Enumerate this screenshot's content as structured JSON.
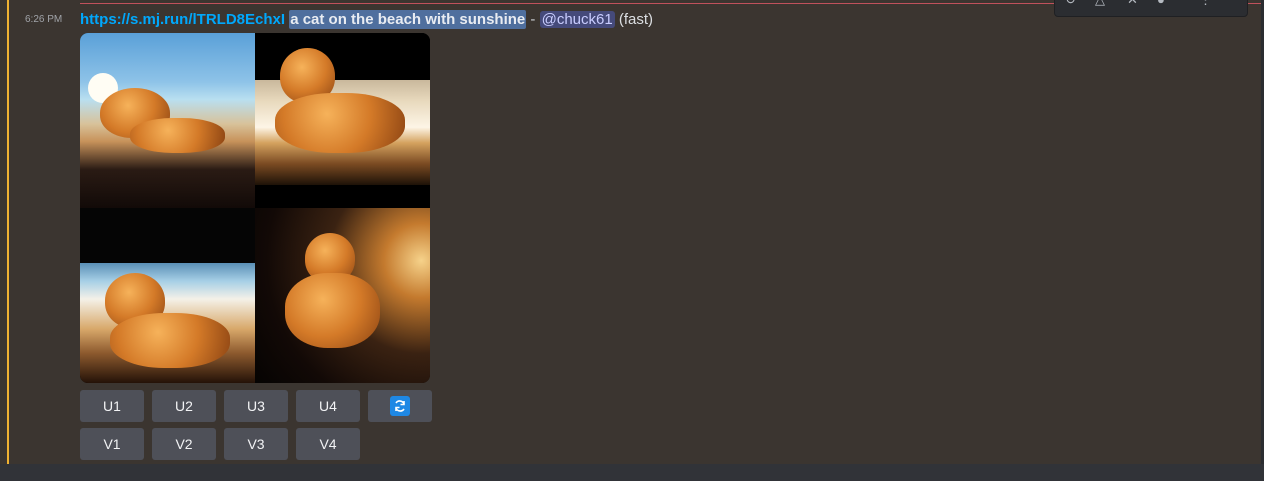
{
  "message": {
    "timestamp": "6:26 PM",
    "link": "https://s.mj.run/lTRLD8EchxI",
    "prompt": "a cat on the beach with sunshine",
    "separator": "-",
    "mention": "@chuck61",
    "speed": "(fast)"
  },
  "image_grid": {
    "tiles": [
      {
        "name": "image-tile-1"
      },
      {
        "name": "image-tile-2"
      },
      {
        "name": "image-tile-3"
      },
      {
        "name": "image-tile-4"
      }
    ]
  },
  "buttons": {
    "upscale": [
      "U1",
      "U2",
      "U3",
      "U4"
    ],
    "variation": [
      "V1",
      "V2",
      "V3",
      "V4"
    ],
    "reroll_icon": "refresh-icon"
  },
  "toolbar": {
    "icons": [
      "reaction-icon",
      "reply-icon",
      "pin-icon",
      "more-icon",
      "overflow-icon"
    ]
  },
  "colors": {
    "accent_bar": "#f0b232",
    "link": "#00a8fc",
    "button_bg": "#4e5058",
    "reroll_blue": "#1e88e5"
  }
}
